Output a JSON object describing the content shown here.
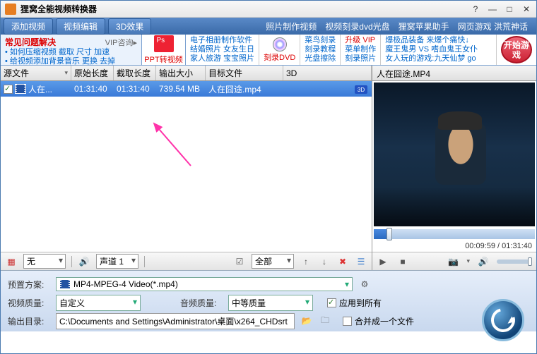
{
  "window": {
    "title": "狸窝全能视频转换器"
  },
  "toolbar": {
    "add_video": "添加视频",
    "video_edit": "视频编辑",
    "effect_3d": "3D效果",
    "links": [
      "照片制作视频",
      "视频刻录dvd光盘",
      "狸窝苹果助手",
      "网页游戏 洪荒神话"
    ]
  },
  "promo": {
    "faq_title": "常见问题解决",
    "vip": "VIP咨询▸",
    "faq_items": [
      "如何压缩视频 截取 尺寸 加速",
      "给视频添加背景音乐 更换 去掉"
    ],
    "ppt": "PPT转视频",
    "col1": [
      "电子相册制作软件",
      "结婚照片 女友生日",
      "家人旅游 宝宝照片"
    ],
    "dvd": "刻录DVD",
    "col2": [
      "菜鸟刻录",
      "刻录教程",
      "光盘擦除"
    ],
    "col2b": [
      "升级 VIP",
      "菜单制作",
      "刻录照片"
    ],
    "col3": [
      "爆极品装备 来爆个痛快↓",
      "魔王鬼男 VS 嗜血鬼王女仆",
      "女人玩的游戏:九天仙梦 go"
    ],
    "start": "开始游戏"
  },
  "table": {
    "headers": {
      "src": "源文件",
      "orig_len": "原始长度",
      "cut_len": "截取长度",
      "out_size": "输出大小",
      "target": "目标文件",
      "d3": "3D"
    },
    "row": {
      "name": "人在...",
      "orig": "01:31:40",
      "cut": "01:31:40",
      "size": "739.54 MB",
      "target": "人在囧途.mp4"
    }
  },
  "leftbar": {
    "sub_none": "无",
    "audio_track": "声道 1",
    "all": "全部"
  },
  "preview": {
    "title": "人在囧途.MP4",
    "time": "00:09:59 / 01:31:40"
  },
  "bottom": {
    "preset_lbl": "预置方案:",
    "preset_val": "MP4-MPEG-4 Video(*.mp4)",
    "vq_lbl": "视频质量:",
    "vq_val": "自定义",
    "aq_lbl": "音频质量:",
    "aq_val": "中等质量",
    "apply_all": "应用到所有",
    "outdir_lbl": "输出目录:",
    "outdir_val": "C:\\Documents and Settings\\Administrator\\桌面\\x264_CHDsrt",
    "merge": "合并成一个文件"
  }
}
